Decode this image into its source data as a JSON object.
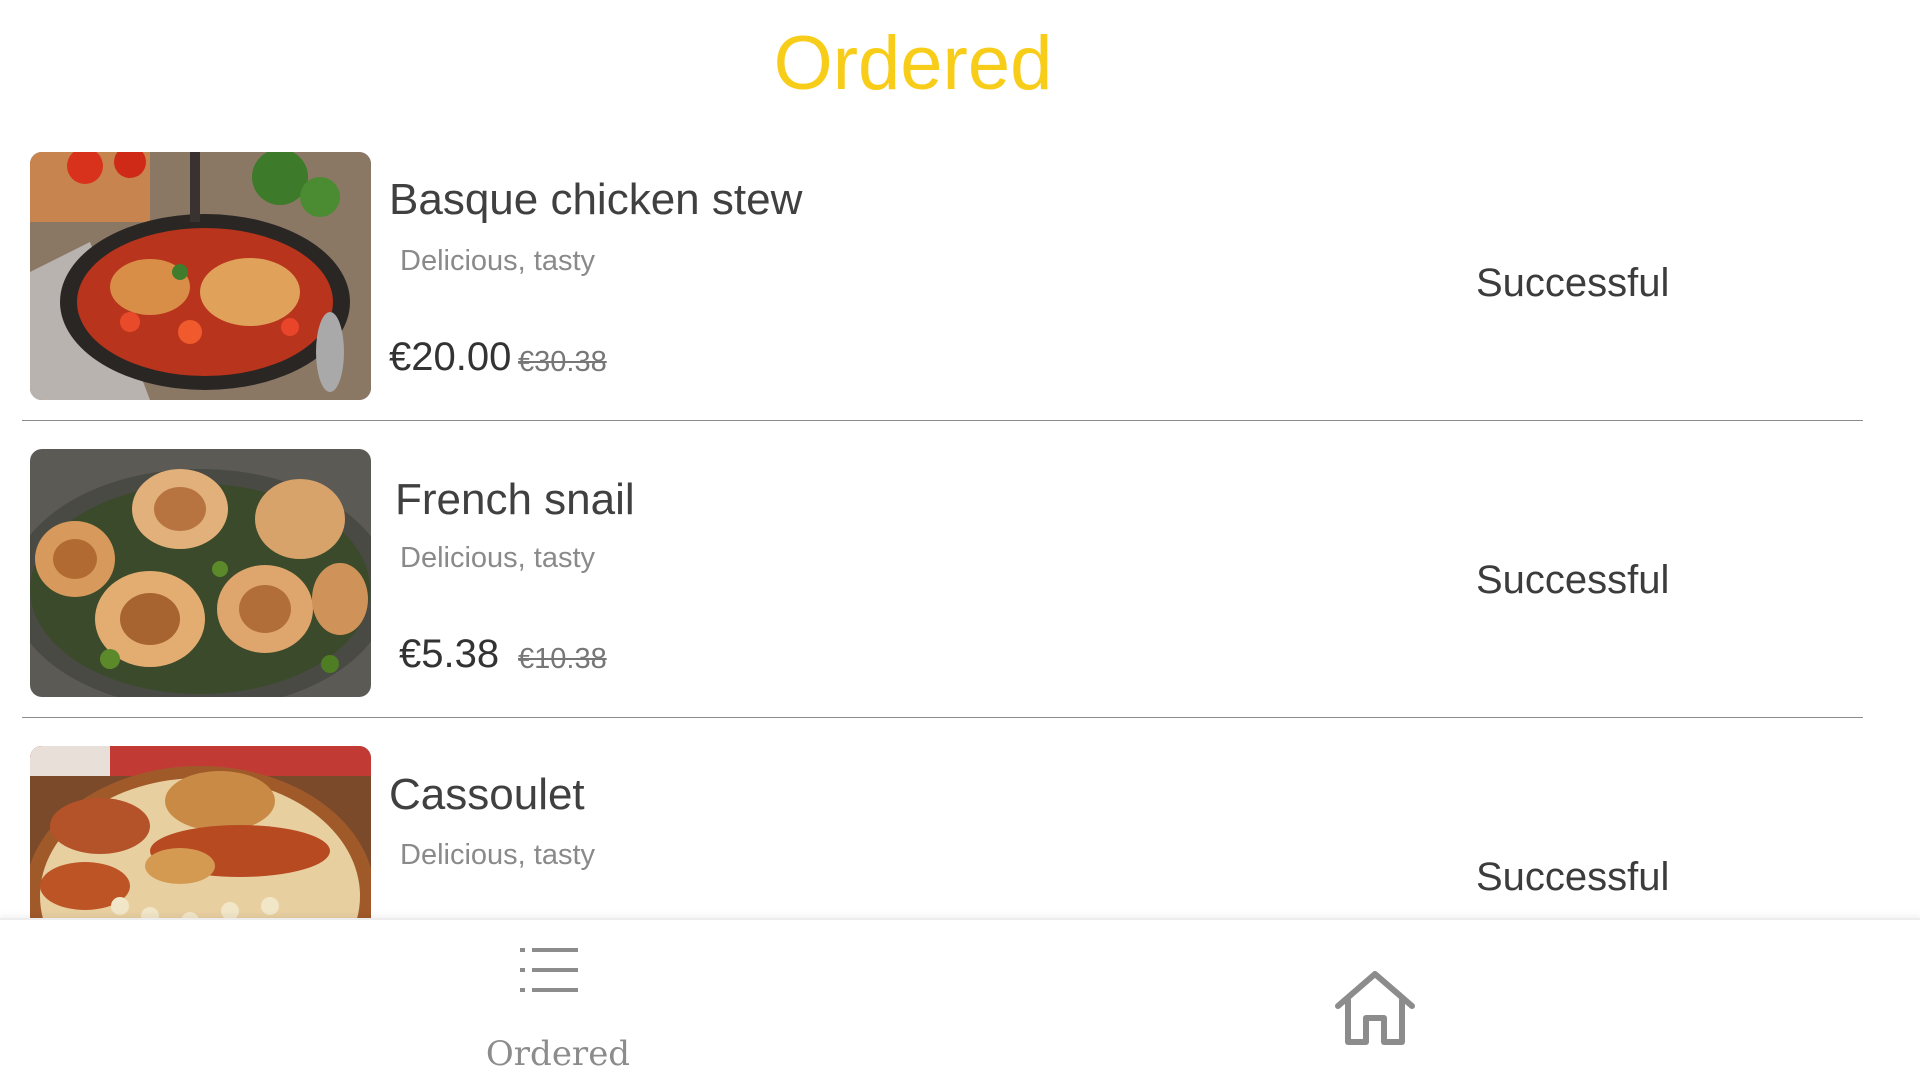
{
  "header": {
    "title": "Ordered"
  },
  "orders": [
    {
      "name": "Basque chicken stew",
      "description": "Delicious, tasty",
      "price": "€20.00",
      "original_price": "€30.38",
      "status": "Successful"
    },
    {
      "name": "French snail",
      "description": "Delicious, tasty",
      "price": "€5.38",
      "original_price": "€10.38",
      "status": "Successful"
    },
    {
      "name": "Cassoulet",
      "description": "Delicious, tasty",
      "status": "Successful"
    }
  ],
  "tabbar": {
    "ordered_label": "Ordered",
    "ordered_icon": "list-icon",
    "home_icon": "home-icon"
  },
  "colors": {
    "title_accent": "#f8cd1a",
    "icon_gray": "#8c8c8c",
    "divider": "#8c8c8c"
  }
}
